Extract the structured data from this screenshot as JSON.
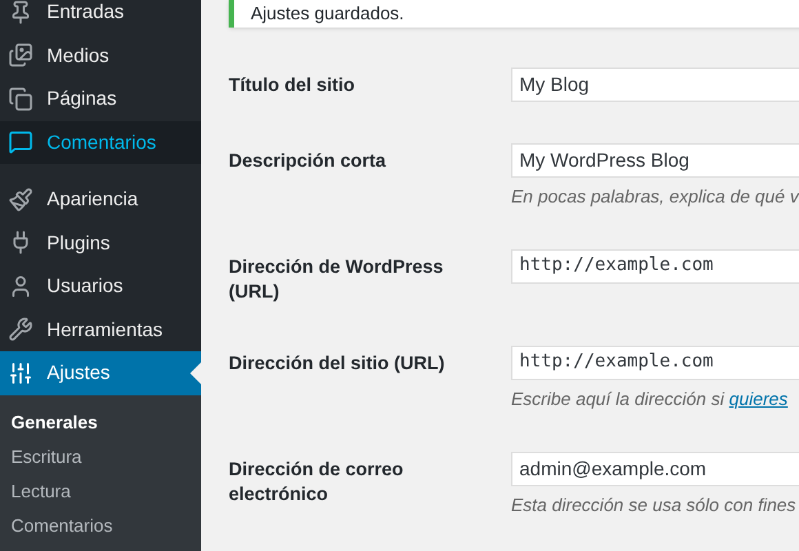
{
  "sidebar": {
    "items": [
      {
        "label": "Entradas",
        "selected": false,
        "hovered": false
      },
      {
        "label": "Medios",
        "selected": false,
        "hovered": false
      },
      {
        "label": "Páginas",
        "selected": false,
        "hovered": false
      },
      {
        "label": "Comentarios",
        "selected": false,
        "hovered": true
      },
      {
        "label": "Apariencia",
        "selected": false,
        "hovered": false
      },
      {
        "label": "Plugins",
        "selected": false,
        "hovered": false
      },
      {
        "label": "Usuarios",
        "selected": false,
        "hovered": false
      },
      {
        "label": "Herramientas",
        "selected": false,
        "hovered": false
      },
      {
        "label": "Ajustes",
        "selected": true,
        "hovered": false
      }
    ],
    "submenu": [
      {
        "label": "Generales",
        "selected": true
      },
      {
        "label": "Escritura",
        "selected": false
      },
      {
        "label": "Lectura",
        "selected": false
      },
      {
        "label": "Comentarios",
        "selected": false
      }
    ]
  },
  "notice": {
    "text": "Ajustes guardados."
  },
  "fields": [
    {
      "label": "Título del sitio",
      "value": "My Blog",
      "mono": false
    },
    {
      "label": "Descripción corta",
      "value": "My WordPress Blog",
      "mono": false,
      "hint": "En pocas palabras, explica de qué v"
    },
    {
      "label": "Dirección de WordPress (URL)",
      "value": "http://example.com",
      "mono": true
    },
    {
      "label": "Dirección del sitio (URL)",
      "value": "http://example.com",
      "mono": true,
      "hint": "Escribe aquí la dirección si",
      "hint_link": "quieres"
    },
    {
      "label": "Dirección de correo electrónico",
      "value": "admin@example.com",
      "mono": false,
      "hint": "Esta dirección se usa sólo con fines"
    }
  ]
}
